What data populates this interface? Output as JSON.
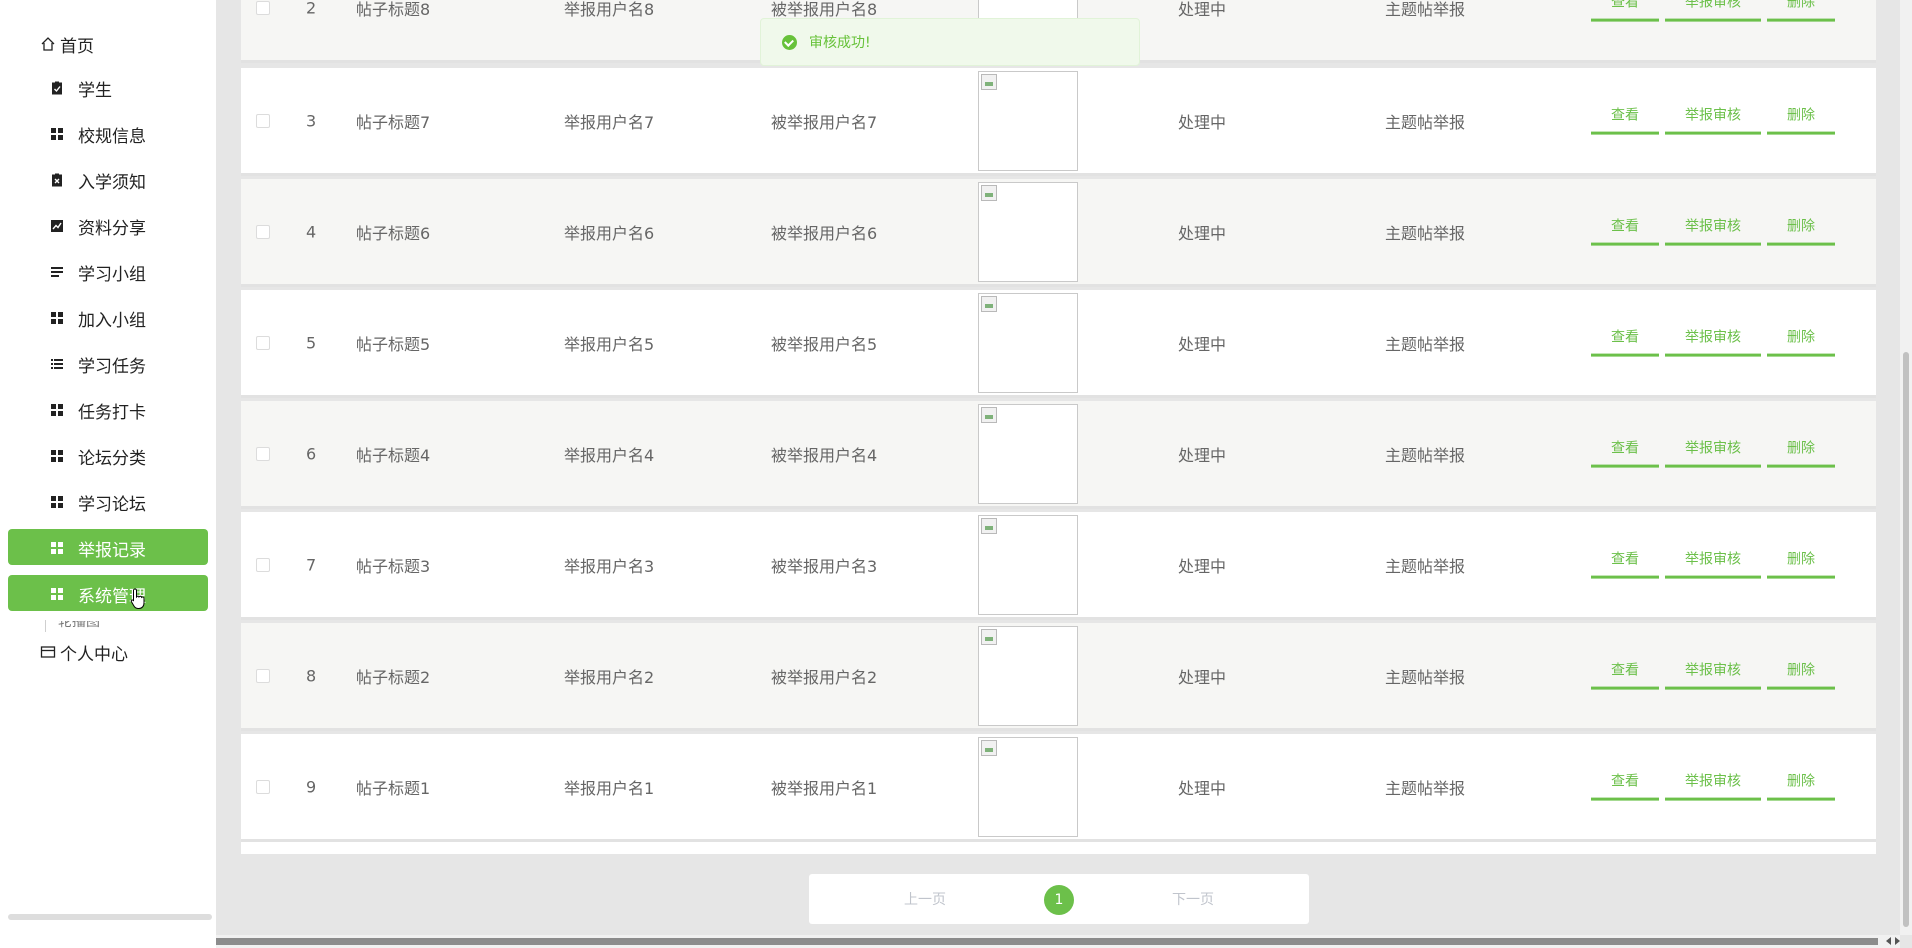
{
  "sidebar": {
    "home": "首页",
    "items": [
      {
        "label": "学生",
        "icon": "clipboard-check-icon"
      },
      {
        "label": "校规信息",
        "icon": "grid-icon"
      },
      {
        "label": "入学须知",
        "icon": "clipboard-x-icon"
      },
      {
        "label": "资料分享",
        "icon": "chart-icon"
      },
      {
        "label": "学习小组",
        "icon": "list-icon"
      },
      {
        "label": "加入小组",
        "icon": "grid-icon"
      },
      {
        "label": "学习任务",
        "icon": "list-ordered-icon"
      },
      {
        "label": "任务打卡",
        "icon": "grid-icon"
      },
      {
        "label": "论坛分类",
        "icon": "grid-icon"
      },
      {
        "label": "学习论坛",
        "icon": "grid-icon"
      },
      {
        "label": "举报记录",
        "icon": "grid-icon"
      },
      {
        "label": "系统管理",
        "icon": "grid-icon"
      }
    ],
    "sub_peek": "轮播图",
    "profile": "个人中心",
    "accent": "#6cc04a"
  },
  "toast": {
    "message": "审核成功!",
    "color": "#67c23a"
  },
  "table": {
    "rows": [
      {
        "index": "2",
        "title": "帖子标题8",
        "reporter": "举报用户名8",
        "reported": "被举报用户名8",
        "status": "处理中",
        "type": "主题帖举报"
      },
      {
        "index": "3",
        "title": "帖子标题7",
        "reporter": "举报用户名7",
        "reported": "被举报用户名7",
        "status": "处理中",
        "type": "主题帖举报"
      },
      {
        "index": "4",
        "title": "帖子标题6",
        "reporter": "举报用户名6",
        "reported": "被举报用户名6",
        "status": "处理中",
        "type": "主题帖举报"
      },
      {
        "index": "5",
        "title": "帖子标题5",
        "reporter": "举报用户名5",
        "reported": "被举报用户名5",
        "status": "处理中",
        "type": "主题帖举报"
      },
      {
        "index": "6",
        "title": "帖子标题4",
        "reporter": "举报用户名4",
        "reported": "被举报用户名4",
        "status": "处理中",
        "type": "主题帖举报"
      },
      {
        "index": "7",
        "title": "帖子标题3",
        "reporter": "举报用户名3",
        "reported": "被举报用户名3",
        "status": "处理中",
        "type": "主题帖举报"
      },
      {
        "index": "8",
        "title": "帖子标题2",
        "reporter": "举报用户名2",
        "reported": "被举报用户名2",
        "status": "处理中",
        "type": "主题帖举报"
      },
      {
        "index": "9",
        "title": "帖子标题1",
        "reporter": "举报用户名1",
        "reported": "被举报用户名1",
        "status": "处理中",
        "type": "主题帖举报"
      }
    ],
    "actions": {
      "view": "查看",
      "audit": "举报审核",
      "delete": "删除"
    }
  },
  "pagination": {
    "prev": "上一页",
    "current": "1",
    "next": "下一页"
  }
}
